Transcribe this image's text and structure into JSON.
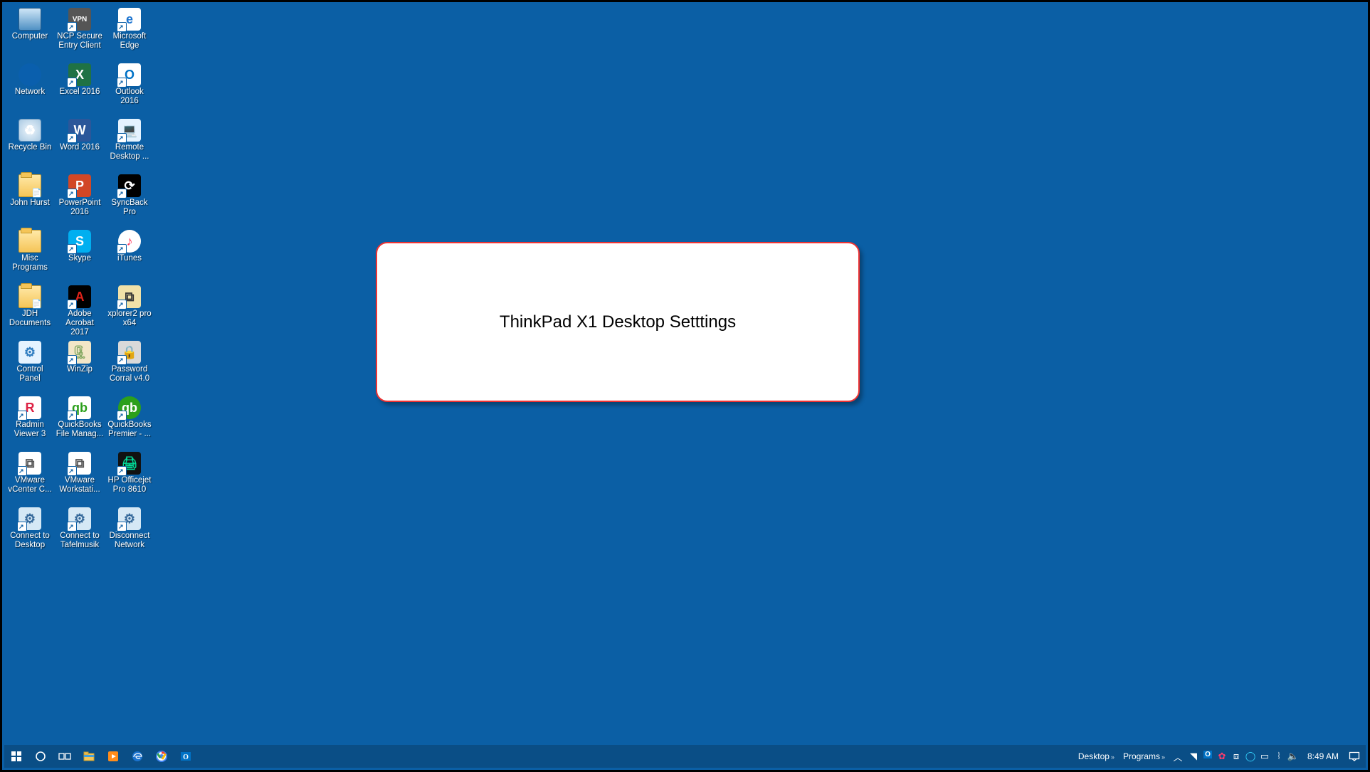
{
  "desktop": {
    "icons": [
      {
        "row": 0,
        "col": 0,
        "label": "Computer",
        "icon": "computer-icon",
        "kind": "monitor"
      },
      {
        "row": 0,
        "col": 1,
        "label": "NCP Secure Entry Client",
        "icon": "vpn-icon",
        "kind": "app-box vpn shortcut",
        "glyph": "VPN"
      },
      {
        "row": 0,
        "col": 2,
        "label": "Microsoft Edge",
        "icon": "edge-icon",
        "kind": "app-box edge shortcut",
        "glyph": "e"
      },
      {
        "row": 1,
        "col": 0,
        "label": "Network",
        "icon": "network-icon",
        "kind": "netblue"
      },
      {
        "row": 1,
        "col": 1,
        "label": "Excel 2016",
        "icon": "excel-icon",
        "kind": "app-box excel shortcut",
        "glyph": "X"
      },
      {
        "row": 1,
        "col": 2,
        "label": "Outlook 2016",
        "icon": "outlook-icon",
        "kind": "app-box outlook shortcut",
        "glyph": "O"
      },
      {
        "row": 2,
        "col": 0,
        "label": "Recycle Bin",
        "icon": "recycle-bin-icon",
        "kind": "bin",
        "glyph": "♻"
      },
      {
        "row": 2,
        "col": 1,
        "label": "Word 2016",
        "icon": "word-icon",
        "kind": "app-box word shortcut",
        "glyph": "W"
      },
      {
        "row": 2,
        "col": 2,
        "label": "Remote Desktop ...",
        "icon": "remote-desktop-icon",
        "kind": "app-box cp shortcut",
        "glyph": "💻"
      },
      {
        "row": 3,
        "col": 0,
        "label": "John Hurst",
        "icon": "user-folder-icon",
        "kind": "folder fm"
      },
      {
        "row": 3,
        "col": 1,
        "label": "PowerPoint 2016",
        "icon": "powerpoint-icon",
        "kind": "app-box ppt shortcut",
        "glyph": "P"
      },
      {
        "row": 3,
        "col": 2,
        "label": "SyncBack Pro",
        "icon": "syncback-icon",
        "kind": "app-box sync shortcut",
        "glyph": "⟳"
      },
      {
        "row": 4,
        "col": 0,
        "label": "Misc Programs",
        "icon": "misc-folder-icon",
        "kind": "folder"
      },
      {
        "row": 4,
        "col": 1,
        "label": "Skype",
        "icon": "skype-icon",
        "kind": "app-box skype shortcut",
        "glyph": "S"
      },
      {
        "row": 4,
        "col": 2,
        "label": "iTunes",
        "icon": "itunes-icon",
        "kind": "app-box itunes shortcut",
        "glyph": "♪"
      },
      {
        "row": 5,
        "col": 0,
        "label": "JDH Documents",
        "icon": "jdh-folder-icon",
        "kind": "folder fm"
      },
      {
        "row": 5,
        "col": 1,
        "label": "Adobe Acrobat 2017",
        "icon": "acrobat-icon",
        "kind": "app-box acrobat shortcut",
        "glyph": "A"
      },
      {
        "row": 5,
        "col": 2,
        "label": "xplorer2 pro x64",
        "icon": "xplorer2-icon",
        "kind": "app-box xplorer shortcut",
        "glyph": "⧉"
      },
      {
        "row": 6,
        "col": 0,
        "label": "Control Panel",
        "icon": "control-panel-icon",
        "kind": "app-box cp",
        "glyph": "⚙"
      },
      {
        "row": 6,
        "col": 1,
        "label": "WinZip",
        "icon": "winzip-icon",
        "kind": "app-box winzip shortcut",
        "glyph": "🗜"
      },
      {
        "row": 6,
        "col": 2,
        "label": "Password Corral v4.0",
        "icon": "password-corral-icon",
        "kind": "app-box pwd shortcut",
        "glyph": "🔒"
      },
      {
        "row": 7,
        "col": 0,
        "label": "Radmin Viewer 3",
        "icon": "radmin-icon",
        "kind": "app-box radmin shortcut",
        "glyph": "R"
      },
      {
        "row": 7,
        "col": 1,
        "label": "QuickBooks File Manag...",
        "icon": "quickbooks-fm-icon",
        "kind": "app-box qbfm shortcut",
        "glyph": "qb"
      },
      {
        "row": 7,
        "col": 2,
        "label": "QuickBooks Premier - ...",
        "icon": "quickbooks-premier-icon",
        "kind": "app-box qbp shortcut",
        "glyph": "qb"
      },
      {
        "row": 8,
        "col": 0,
        "label": "VMware vCenter C...",
        "icon": "vmware-vcenter-icon",
        "kind": "app-box vmware shortcut",
        "glyph": "⧉"
      },
      {
        "row": 8,
        "col": 1,
        "label": "VMware Workstati...",
        "icon": "vmware-workstation-icon",
        "kind": "app-box vmware shortcut",
        "glyph": "⧉"
      },
      {
        "row": 8,
        "col": 2,
        "label": "HP Officejet Pro 8610",
        "icon": "hp-printer-icon",
        "kind": "app-box hp shortcut",
        "glyph": "🖨"
      },
      {
        "row": 9,
        "col": 0,
        "label": "Connect to Desktop",
        "icon": "connect-desktop-icon",
        "kind": "app-box scriptbox shortcut",
        "glyph": "⚙"
      },
      {
        "row": 9,
        "col": 1,
        "label": "Connect to Tafelmusik",
        "icon": "connect-tafelmusik-icon",
        "kind": "app-box scriptbox shortcut",
        "glyph": "⚙"
      },
      {
        "row": 9,
        "col": 2,
        "label": "Disconnect Network",
        "icon": "disconnect-network-icon",
        "kind": "app-box scriptbox shortcut",
        "glyph": "⚙"
      }
    ]
  },
  "callout": {
    "text": "ThinkPad X1 Desktop Setttings"
  },
  "taskbar": {
    "left": [
      {
        "name": "start-button",
        "icon": "windows-logo-icon"
      },
      {
        "name": "cortana-button",
        "icon": "cortana-circle-icon"
      },
      {
        "name": "task-view-button",
        "icon": "task-view-icon"
      },
      {
        "name": "file-explorer-button",
        "icon": "file-explorer-icon"
      },
      {
        "name": "media-player-button",
        "icon": "media-player-icon"
      },
      {
        "name": "edge-button",
        "icon": "edge-icon"
      },
      {
        "name": "chrome-button",
        "icon": "chrome-icon"
      },
      {
        "name": "outlook-button",
        "icon": "outlook-icon"
      }
    ],
    "toolbars": [
      {
        "name": "desktop-toolbar",
        "label": "Desktop"
      },
      {
        "name": "programs-toolbar",
        "label": "Programs"
      }
    ],
    "tray_overflow_glyph": "︿",
    "tray": [
      {
        "name": "steam-tray-icon",
        "glyph": "◥"
      },
      {
        "name": "outlook-tray-icon",
        "glyph": "O"
      },
      {
        "name": "snagit-tray-icon",
        "glyph": "✿"
      },
      {
        "name": "dropbox-tray-icon",
        "glyph": "⧈"
      },
      {
        "name": "focused-tray-icon",
        "glyph": "◯"
      },
      {
        "name": "network-tray-icon",
        "glyph": "▭"
      },
      {
        "name": "wifi-tray-icon",
        "glyph": "⦚"
      },
      {
        "name": "volume-tray-icon",
        "glyph": "🔈"
      }
    ],
    "clock": "8:49 AM",
    "action_center_glyph": "▭"
  }
}
